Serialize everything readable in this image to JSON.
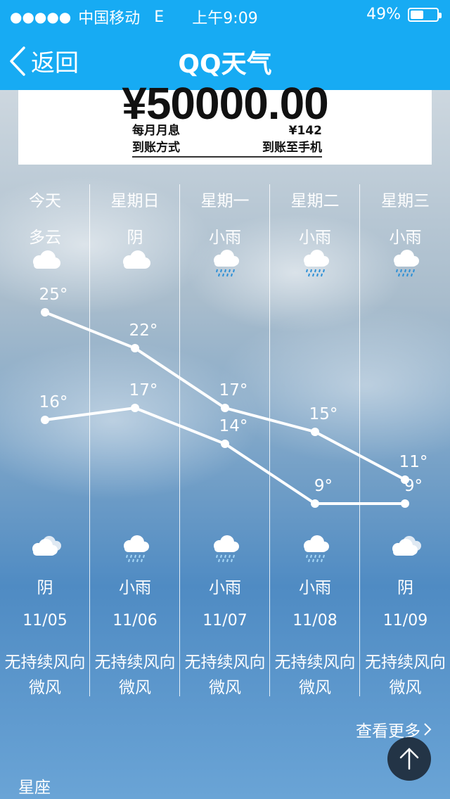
{
  "status_bar": {
    "signal_dots": "●●●●●",
    "carrier": "中国移动",
    "network": "E",
    "time": "上午9:09",
    "battery_percent": "49%",
    "battery_level": 0.49
  },
  "nav": {
    "back_label": "返回",
    "title": "QQ天气"
  },
  "ad": {
    "amount": "¥50000.00",
    "left_line1": "每月月息",
    "left_line2": "到账方式",
    "right_line1": "¥142",
    "right_line2": "到账至手机"
  },
  "forecast": [
    {
      "day": "今天",
      "condition_day": "多云",
      "icon_day": "cloudy-icon",
      "high": "25°",
      "low": "16°",
      "condition_night": "阴",
      "icon_night": "overcast-icon",
      "date": "11/05",
      "wind": "无持续风向",
      "wind_level": "微风"
    },
    {
      "day": "星期日",
      "condition_day": "阴",
      "icon_day": "overcast-icon",
      "high": "22°",
      "low": "17°",
      "condition_night": "小雨",
      "icon_night": "light-rain-icon",
      "date": "11/06",
      "wind": "无持续风向",
      "wind_level": "微风"
    },
    {
      "day": "星期一",
      "condition_day": "小雨",
      "icon_day": "light-rain-icon",
      "high": "17°",
      "low": "14°",
      "condition_night": "小雨",
      "icon_night": "light-rain-icon",
      "date": "11/07",
      "wind": "无持续风向",
      "wind_level": "微风"
    },
    {
      "day": "星期二",
      "condition_day": "小雨",
      "icon_day": "light-rain-icon",
      "high": "15°",
      "low": "9°",
      "condition_night": "小雨",
      "icon_night": "light-rain-icon",
      "date": "11/08",
      "wind": "无持续风向",
      "wind_level": "微风"
    },
    {
      "day": "星期三",
      "condition_day": "小雨",
      "icon_day": "light-rain-icon",
      "high": "11°",
      "low": "9°",
      "condition_night": "阴",
      "icon_night": "overcast-icon",
      "date": "11/09",
      "wind": "无持续风向",
      "wind_level": "微风"
    }
  ],
  "chart_data": {
    "type": "line",
    "categories": [
      "11/05",
      "11/06",
      "11/07",
      "11/08",
      "11/09"
    ],
    "series": [
      {
        "values": [
          25,
          22,
          17,
          15,
          11
        ]
      },
      {
        "values": [
          16,
          17,
          14,
          9,
          9
        ]
      }
    ],
    "color": "#ffffff"
  },
  "footer": {
    "more_label": "查看更多",
    "section_label": "星座"
  }
}
